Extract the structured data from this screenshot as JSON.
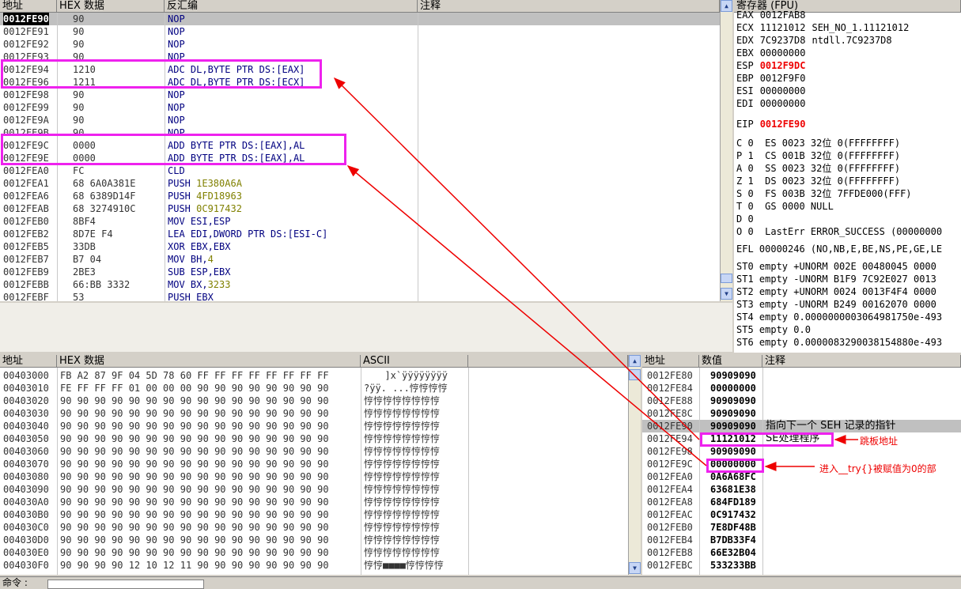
{
  "disasm": {
    "headers": [
      "地址",
      "HEX 数据",
      "反汇编",
      "注释"
    ],
    "rows": [
      {
        "addr": "0012FE90",
        "hex": "90",
        "asm": "NOP"
      },
      {
        "addr": "0012FE91",
        "hex": "90",
        "asm": "NOP"
      },
      {
        "addr": "0012FE92",
        "hex": "90",
        "asm": "NOP"
      },
      {
        "addr": "0012FE93",
        "hex": "90",
        "asm": "NOP"
      },
      {
        "addr": "0012FE94",
        "hex": "1210",
        "asm": "ADC DL,BYTE PTR DS:[EAX]"
      },
      {
        "addr": "0012FE96",
        "hex": "1211",
        "asm": "ADC DL,BYTE PTR DS:[ECX]"
      },
      {
        "addr": "0012FE98",
        "hex": "90",
        "asm": "NOP"
      },
      {
        "addr": "0012FE99",
        "hex": "90",
        "asm": "NOP"
      },
      {
        "addr": "0012FE9A",
        "hex": "90",
        "asm": "NOP"
      },
      {
        "addr": "0012FE9B",
        "hex": "90",
        "asm": "NOP"
      },
      {
        "addr": "0012FE9C",
        "hex": "0000",
        "asm": "ADD BYTE PTR DS:[EAX],AL"
      },
      {
        "addr": "0012FE9E",
        "hex": "0000",
        "asm": "ADD BYTE PTR DS:[EAX],AL"
      },
      {
        "addr": "0012FEA0",
        "hex": "FC",
        "asm": "CLD"
      },
      {
        "addr": "0012FEA1",
        "hex": "68 6A0A381E",
        "asm_op": "PUSH ",
        "asm_arg": "1E380A6A"
      },
      {
        "addr": "0012FEA6",
        "hex": "68 6389D14F",
        "asm_op": "PUSH ",
        "asm_arg": "4FD18963"
      },
      {
        "addr": "0012FEAB",
        "hex": "68 3274910C",
        "asm_op": "PUSH ",
        "asm_arg": "0C917432"
      },
      {
        "addr": "0012FEB0",
        "hex": "8BF4",
        "asm": "MOV ESI,ESP"
      },
      {
        "addr": "0012FEB2",
        "hex": "8D7E F4",
        "asm": "LEA EDI,DWORD PTR DS:[ESI-C]"
      },
      {
        "addr": "0012FEB5",
        "hex": "33DB",
        "asm": "XOR EBX,EBX"
      },
      {
        "addr": "0012FEB7",
        "hex": "B7 04",
        "asm_op": "MOV BH,",
        "asm_arg": "4"
      },
      {
        "addr": "0012FEB9",
        "hex": "2BE3",
        "asm": "SUB ESP,EBX"
      },
      {
        "addr": "0012FEBB",
        "hex": "66:BB 3332",
        "asm_op": "MOV BX,",
        "asm_arg": "3233"
      },
      {
        "addr": "0012FEBF",
        "hex": "53",
        "asm": "PUSH EBX"
      }
    ]
  },
  "registers": {
    "title": "寄存器 (FPU)",
    "lines": [
      {
        "name": "EAX",
        "val": "0012FAB8",
        "extra": ""
      },
      {
        "name": "ECX",
        "val": "11121012",
        "extra": "SEH_NO_1.11121012"
      },
      {
        "name": "EDX",
        "val": "7C9237D8",
        "extra": "ntdll.7C9237D8"
      },
      {
        "name": "EBX",
        "val": "00000000",
        "extra": ""
      },
      {
        "name": "ESP",
        "val": "0012F9DC",
        "extra": "",
        "red": true
      },
      {
        "name": "EBP",
        "val": "0012F9F0",
        "extra": ""
      },
      {
        "name": "ESI",
        "val": "00000000",
        "extra": ""
      },
      {
        "name": "EDI",
        "val": "00000000",
        "extra": ""
      }
    ],
    "eip": {
      "name": "EIP",
      "val": "0012FE90"
    },
    "flags": [
      "C 0  ES 0023 32位 0(FFFFFFFF)",
      "P 1  CS 001B 32位 0(FFFFFFFF)",
      "A 0  SS 0023 32位 0(FFFFFFFF)",
      "Z 1  DS 0023 32位 0(FFFFFFFF)",
      "S 0  FS 003B 32位 7FFDE000(FFF)",
      "T 0  GS 0000 NULL",
      "D 0",
      "O 0  LastErr ERROR_SUCCESS (00000000"
    ],
    "efl": "EFL 00000246 (NO,NB,E,BE,NS,PE,GE,LE",
    "fpu": [
      "ST0 empty +UNORM 002E 00480045 0000",
      "ST1 empty -UNORM B1F9 7C92E027 0013",
      "ST2 empty +UNORM 0024 0013F4F4 0000",
      "ST3 empty -UNORM B249 00162070 0000",
      "ST4 empty 0.0000000003064981750e-493",
      "ST5 empty 0.0",
      "ST6 empty 0.0000083290038154880e-493"
    ]
  },
  "dump": {
    "headers": [
      "地址",
      "HEX 数据",
      "ASCII"
    ],
    "rows": [
      {
        "addr": "00403000",
        "hex": "FB A2 87 9F 04 5D 78 60 FF FF FF FF FF FF FF FF",
        "ascii": " 　 ]x`ÿÿÿÿÿÿÿÿ"
      },
      {
        "addr": "00403010",
        "hex": "FE FF FF FF 01 00 00 00 90 90 90 90 90 90 90 90",
        "ascii": "?ÿÿ. ...悙悙悙悙"
      },
      {
        "addr": "00403020",
        "hex": "90 90 90 90 90 90 90 90 90 90 90 90 90 90 90 90",
        "ascii": "悙悙悙悙悙悙悙悙"
      },
      {
        "addr": "00403030",
        "hex": "90 90 90 90 90 90 90 90 90 90 90 90 90 90 90 90",
        "ascii": "悙悙悙悙悙悙悙悙"
      },
      {
        "addr": "00403040",
        "hex": "90 90 90 90 90 90 90 90 90 90 90 90 90 90 90 90",
        "ascii": "悙悙悙悙悙悙悙悙"
      },
      {
        "addr": "00403050",
        "hex": "90 90 90 90 90 90 90 90 90 90 90 90 90 90 90 90",
        "ascii": "悙悙悙悙悙悙悙悙"
      },
      {
        "addr": "00403060",
        "hex": "90 90 90 90 90 90 90 90 90 90 90 90 90 90 90 90",
        "ascii": "悙悙悙悙悙悙悙悙"
      },
      {
        "addr": "00403070",
        "hex": "90 90 90 90 90 90 90 90 90 90 90 90 90 90 90 90",
        "ascii": "悙悙悙悙悙悙悙悙"
      },
      {
        "addr": "00403080",
        "hex": "90 90 90 90 90 90 90 90 90 90 90 90 90 90 90 90",
        "ascii": "悙悙悙悙悙悙悙悙"
      },
      {
        "addr": "00403090",
        "hex": "90 90 90 90 90 90 90 90 90 90 90 90 90 90 90 90",
        "ascii": "悙悙悙悙悙悙悙悙"
      },
      {
        "addr": "004030A0",
        "hex": "90 90 90 90 90 90 90 90 90 90 90 90 90 90 90 90",
        "ascii": "悙悙悙悙悙悙悙悙"
      },
      {
        "addr": "004030B0",
        "hex": "90 90 90 90 90 90 90 90 90 90 90 90 90 90 90 90",
        "ascii": "悙悙悙悙悙悙悙悙"
      },
      {
        "addr": "004030C0",
        "hex": "90 90 90 90 90 90 90 90 90 90 90 90 90 90 90 90",
        "ascii": "悙悙悙悙悙悙悙悙"
      },
      {
        "addr": "004030D0",
        "hex": "90 90 90 90 90 90 90 90 90 90 90 90 90 90 90 90",
        "ascii": "悙悙悙悙悙悙悙悙"
      },
      {
        "addr": "004030E0",
        "hex": "90 90 90 90 90 90 90 90 90 90 90 90 90 90 90 90",
        "ascii": "悙悙悙悙悙悙悙悙"
      },
      {
        "addr": "004030F0",
        "hex": "90 90 90 90 12 10 12 11 90 90 90 90 90 90 90 90",
        "ascii": "悙悙■■■■悙悙悙悙"
      }
    ]
  },
  "stack": {
    "headers": [
      "地址",
      "数值",
      "注释"
    ],
    "rows": [
      {
        "addr": "0012FE80",
        "val": "90909090",
        "comment": ""
      },
      {
        "addr": "0012FE84",
        "val": "00000000",
        "comment": ""
      },
      {
        "addr": "0012FE88",
        "val": "90909090",
        "comment": ""
      },
      {
        "addr": "0012FE8C",
        "val": "90909090",
        "comment": ""
      },
      {
        "addr": "0012FE90",
        "val": "90909090",
        "comment": "指向下一个 SEH 记录的指针"
      },
      {
        "addr": "0012FE94",
        "val": "11121012",
        "comment": "SE处理程序"
      },
      {
        "addr": "0012FE98",
        "val": "90909090",
        "comment": ""
      },
      {
        "addr": "0012FE9C",
        "val": "00000000",
        "comment": ""
      },
      {
        "addr": "0012FEA0",
        "val": "0A6A68FC",
        "comment": ""
      },
      {
        "addr": "0012FEA4",
        "val": "63681E38",
        "comment": ""
      },
      {
        "addr": "0012FEA8",
        "val": "684FD189",
        "comment": ""
      },
      {
        "addr": "0012FEAC",
        "val": "0C917432",
        "comment": ""
      },
      {
        "addr": "0012FEB0",
        "val": "7E8DF48B",
        "comment": ""
      },
      {
        "addr": "0012FEB4",
        "val": "B7DB33F4",
        "comment": ""
      },
      {
        "addr": "0012FEB8",
        "val": "66E32B04",
        "comment": ""
      },
      {
        "addr": "0012FEBC",
        "val": "533233BB",
        "comment": ""
      }
    ]
  },
  "annotations": {
    "trampoline": "跳板地址",
    "zeroed": "进入__try{}被赋值为0的部"
  },
  "command_bar": {
    "label": "命令 :"
  },
  "colors": {
    "highlight_box": "#ee22ee",
    "arrow": "#ee0000",
    "selection": "#c0c0c0",
    "operand": "#808000",
    "keyword": "#000080"
  }
}
